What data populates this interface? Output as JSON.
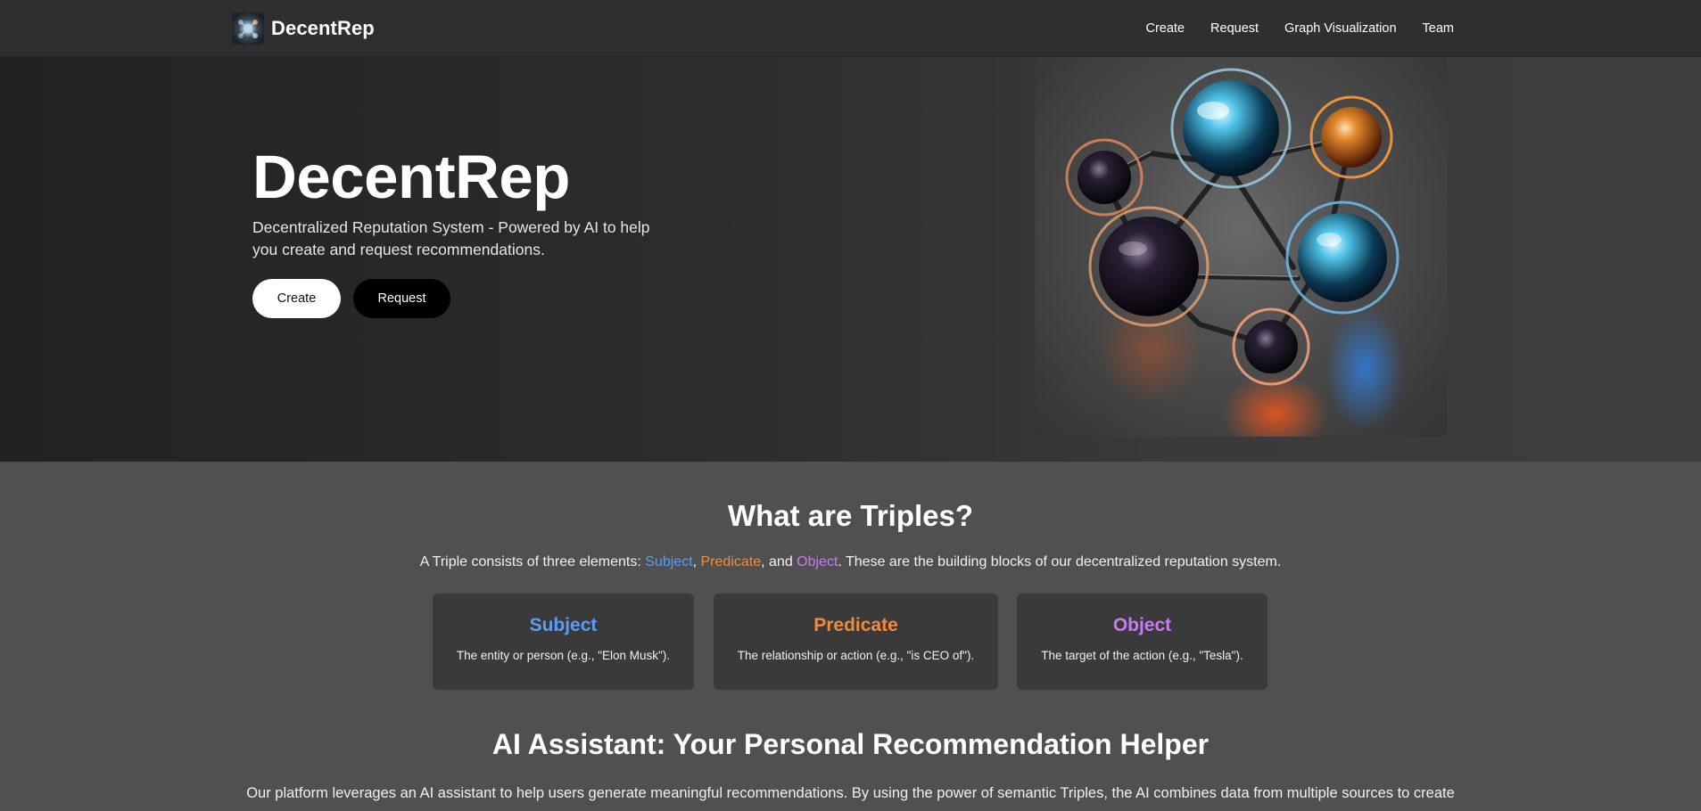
{
  "nav": {
    "brand": "DecentRep",
    "links": [
      "Create",
      "Request",
      "Graph Visualization",
      "Team"
    ]
  },
  "hero": {
    "title": "DecentRep",
    "subtitle": "Decentralized Reputation System - Powered by AI to help you create and request recommendations.",
    "create_label": "Create",
    "request_label": "Request"
  },
  "triples": {
    "title": "What are Triples?",
    "desc_prefix": "A Triple consists of three elements: ",
    "subject_word": "Subject",
    "sep1": ", ",
    "predicate_word": "Predicate",
    "sep2": ", and ",
    "object_word": "Object",
    "desc_suffix": ". These are the building blocks of our decentralized reputation system.",
    "cards": [
      {
        "title": "Subject",
        "desc": "The entity or person (e.g., \"Elon Musk\").",
        "color": "#5b9cf5"
      },
      {
        "title": "Predicate",
        "desc": "The relationship or action (e.g., \"is CEO of\").",
        "color": "#f28a3c"
      },
      {
        "title": "Object",
        "desc": "The target of the action (e.g., \"Tesla\").",
        "color": "#c47cf2"
      }
    ]
  },
  "ai": {
    "title": "AI Assistant: Your Personal Recommendation Helper",
    "desc": "Our platform leverages an AI assistant to help users generate meaningful recommendations. By using the power of semantic Triples, the AI combines data from multiple sources to create"
  },
  "colors": {
    "nav_bg": "#2f2f2f",
    "page_bg": "#505050",
    "card_bg": "#3a3a3a"
  }
}
